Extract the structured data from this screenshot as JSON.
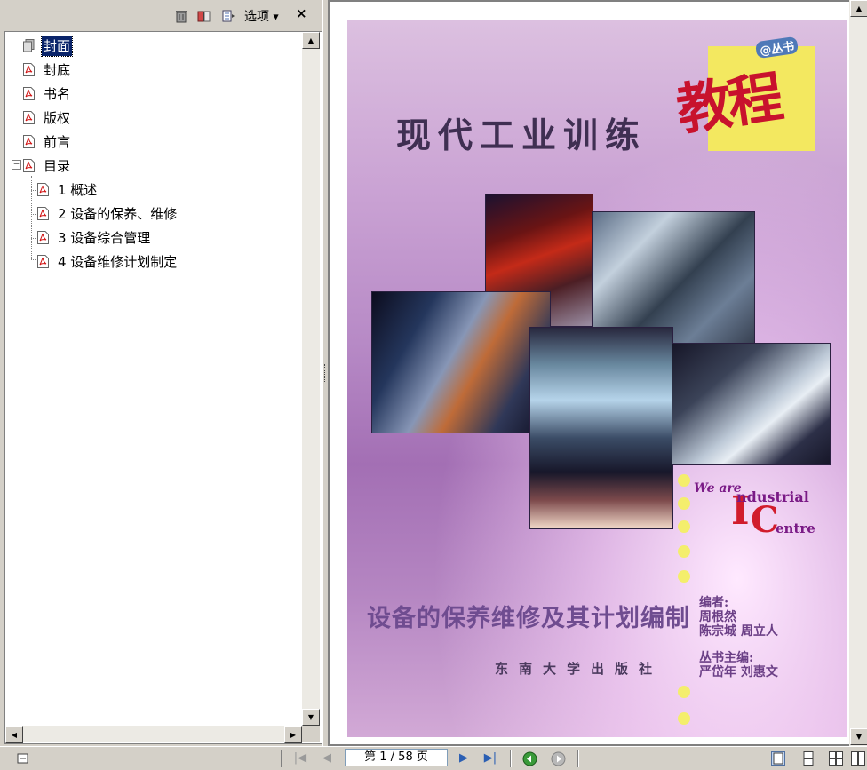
{
  "bookmarks_panel": {
    "options_label": "选项",
    "close_label": "×",
    "items": [
      {
        "label": "封面",
        "selected": true
      },
      {
        "label": "封底"
      },
      {
        "label": "书名"
      },
      {
        "label": "版权"
      },
      {
        "label": "前言"
      },
      {
        "label": "目录",
        "expanded": true
      }
    ],
    "children": [
      {
        "label": "1  概述"
      },
      {
        "label": "2  设备的保养、维修"
      },
      {
        "label": "3  设备综合管理"
      },
      {
        "label": "4  设备维修计划制定"
      }
    ],
    "expander_symbol": "−"
  },
  "cover": {
    "main_title": "现代工业训练",
    "title_accent": "教程",
    "series_badge": "@丛书",
    "logo_we_are": "We are",
    "logo_industrial": "ndustrial",
    "logo_I": "I",
    "logo_C": "C",
    "logo_centre": "entre",
    "subtitle": "设备的保养维修及其计划编制",
    "publisher": "东南大学出版社",
    "credits": [
      "编者:",
      "周根然",
      "陈宗城  周立人",
      "丛书主编:",
      "严岱年  刘惠文"
    ]
  },
  "statusbar": {
    "page_indicator": "第 1 / 58 页"
  },
  "colors": {
    "selection": "#0a246a",
    "accent_red": "#c8122d",
    "cover_purple": "#b78ac6",
    "yellow": "#f3e860"
  }
}
